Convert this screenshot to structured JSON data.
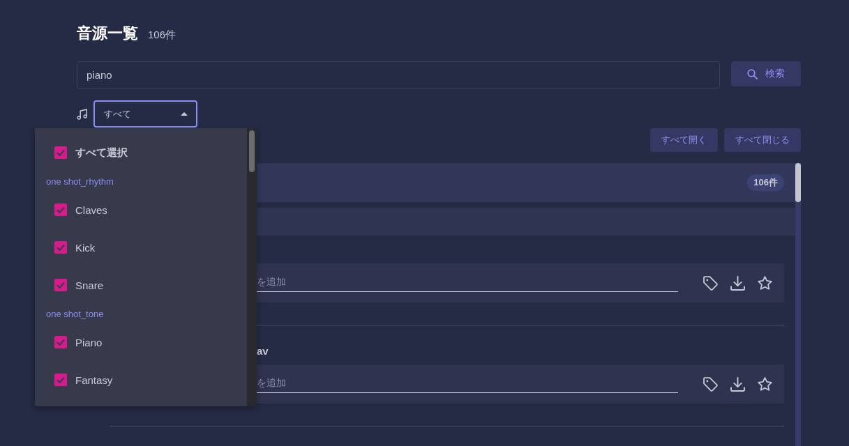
{
  "header": {
    "title": "音源一覧",
    "count": "106件"
  },
  "search": {
    "value": "piano",
    "button": "検索"
  },
  "filter": {
    "value": "すべて",
    "expanded": true
  },
  "dropdown": {
    "select_all": {
      "label": "すべて選択",
      "checked": true
    },
    "groups": [
      {
        "label": "one shot_rhythm",
        "items": [
          {
            "label": "Claves",
            "checked": true
          },
          {
            "label": "Kick",
            "checked": true
          },
          {
            "label": "Snare",
            "checked": true
          }
        ]
      },
      {
        "label": "one shot_tone",
        "items": [
          {
            "label": "Piano",
            "checked": true
          },
          {
            "label": "Fantasy",
            "checked": true
          }
        ]
      }
    ]
  },
  "toolbar": {
    "buttons": [
      "すべて開く",
      "すべて閉じる"
    ]
  },
  "list": {
    "group": {
      "count": "106件"
    },
    "items": [
      {
        "tag_placeholder": "を追加"
      },
      {
        "title": "av",
        "tag_placeholder": "を追加"
      }
    ]
  }
}
